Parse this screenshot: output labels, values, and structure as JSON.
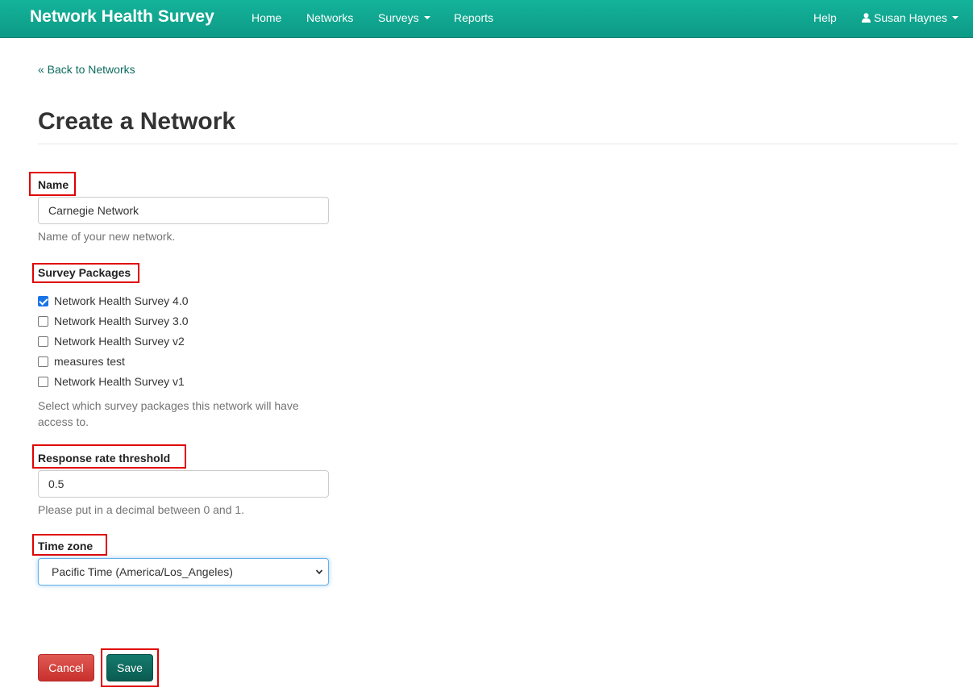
{
  "navbar": {
    "brand": "Network Health Survey",
    "items": [
      "Home",
      "Networks",
      "Surveys",
      "Reports"
    ],
    "help": "Help",
    "user": "Susan Haynes"
  },
  "back_link": "« Back to Networks",
  "page_title": "Create a Network",
  "form": {
    "name": {
      "label": "Name",
      "value": "Carnegie Network",
      "help": "Name of your new network."
    },
    "survey_packages": {
      "label": "Survey Packages",
      "options": [
        {
          "label": "Network Health Survey 4.0",
          "checked": true
        },
        {
          "label": "Network Health Survey 3.0",
          "checked": false
        },
        {
          "label": "Network Health Survey v2",
          "checked": false
        },
        {
          "label": "measures test",
          "checked": false
        },
        {
          "label": "Network Health Survey v1",
          "checked": false
        }
      ],
      "help": "Select which survey packages this network will have access to."
    },
    "response_rate": {
      "label": "Response rate threshold",
      "value": "0.5",
      "help": "Please put in a decimal between 0 and 1."
    },
    "time_zone": {
      "label": "Time zone",
      "selected": "Pacific Time (America/Los_Angeles)"
    }
  },
  "buttons": {
    "cancel": "Cancel",
    "save": "Save"
  },
  "colors": {
    "navbar": "#10a68f",
    "link": "#0d6b5e",
    "cancel": "#c9302c",
    "save": "#0b5c51",
    "highlight": "#e00000"
  }
}
